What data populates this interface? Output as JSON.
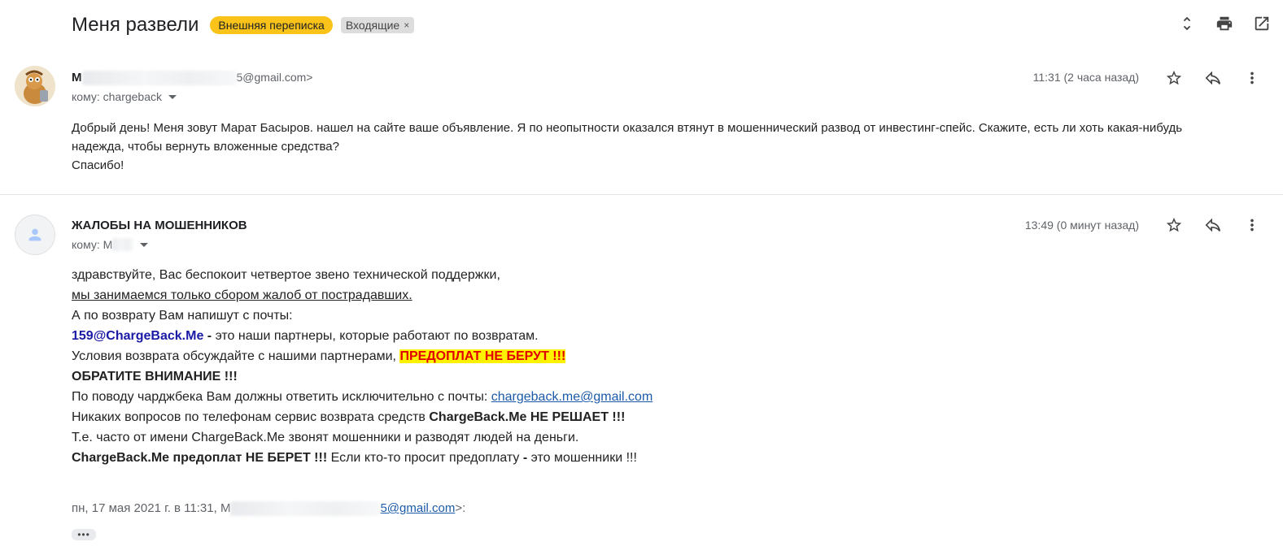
{
  "header": {
    "subject": "Меня развели",
    "labels": {
      "external": "Внешняя переписка",
      "inbox": "Входящие",
      "inbox_remove": "×"
    }
  },
  "messages": [
    {
      "sender_initial": "M",
      "sender_email_tail": "5@gmail.com>",
      "to_line": "кому: chargeback",
      "time": "11:31 (2 часа назад)",
      "body": [
        "Добрый день! Меня зовут Марат Басыров. нашел на сайте ваше объявление. Я по неопытности оказался втянут в мошеннический развод от инвестинг-спейс. Скажите, есть ли хоть какая-нибудь надежда, чтобы вернуть вложенные средства?",
        "Спасибо!"
      ]
    },
    {
      "sender": "ЖАЛОБЫ НА МОШЕННИКОВ",
      "to_line": "кому: М",
      "time": "13:49 (0 минут назад)",
      "body": {
        "l1": "здравствуйте, Вас беспокоит четвертое звено технической поддержки,",
        "l2": "мы занимаемся только сбором жалоб от пострадавших.",
        "l3": "А по возврату Вам напишут с почты:",
        "l4_email": "159@ChargeBack.Me",
        "l4_dash": " - ",
        "l4_rest": "это наши партнеры, которые работают по возвратам.",
        "l5_text": "Условия возврата обсуждайте с нашими партнерами, ",
        "l5_highlight": "ПРЕДОПЛАТ НЕ БЕРУТ !!!",
        "l6": "ОБРАТИТЕ ВНИМАНИЕ !!!",
        "l7_text": "По поводу чарджбека Вам должны ответить исключительно с почты: ",
        "l7_link": "chargeback.me@gmail.com",
        "l8_text": "Никаких вопросов по телефонам сервис возврата средств ",
        "l8_bold": "ChargeBack.Me НЕ РЕШАЕТ !!!",
        "l9": "Т.е. часто от имени ChargeBack.Me звонят мошенники и разводят людей на деньги.",
        "l10_bold": "ChargeBack.Me предоплат НЕ БЕРЕТ !!!",
        "l10_text": " Если кто-то просит предоплату ",
        "l10_dash": "-",
        "l10_rest": " это мошенники !!!"
      },
      "quote": {
        "prefix": "пн, 17 мая 2021 г. в 11:31, М",
        "email_tail": "5@gmail.com",
        "suffix": ">:"
      },
      "ellipsis": "•••"
    }
  ],
  "icons": {
    "top": [
      "expand-collapse-icon",
      "print-icon",
      "open-in-new-window-icon"
    ],
    "message": [
      "star-icon",
      "reply-icon",
      "more-vert-icon"
    ]
  },
  "colors": {
    "external_label": "#f9c319",
    "highlight_bg": "#fff200",
    "highlight_text": "#e00000",
    "link": "#1a5aa8",
    "email_link": "#1a1aa6"
  }
}
